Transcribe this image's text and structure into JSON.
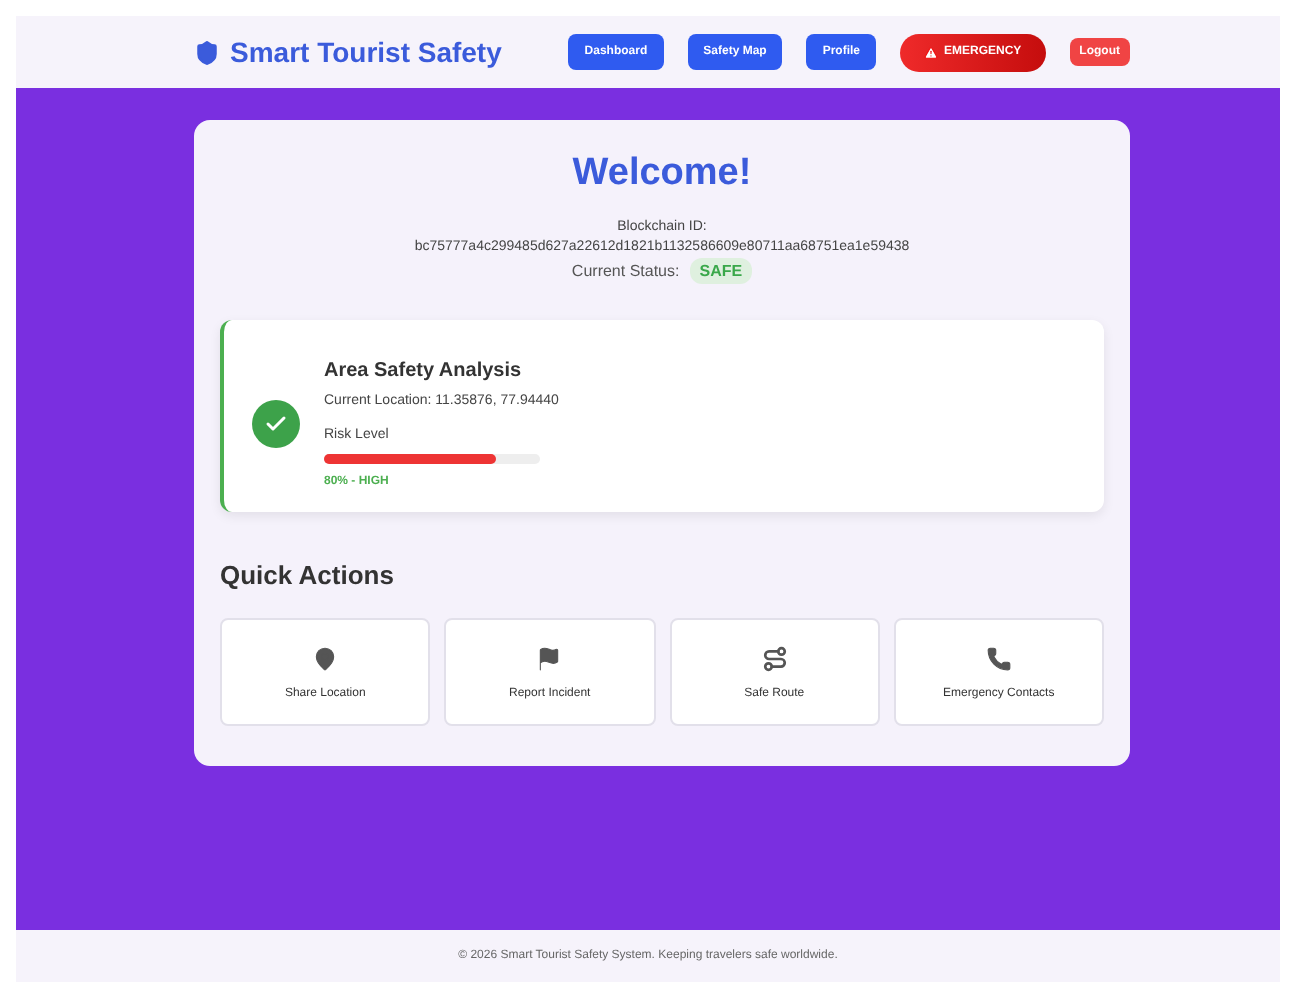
{
  "header": {
    "brand": "Smart Tourist Safety",
    "nav": [
      {
        "label": "Dashboard",
        "kind": "nav"
      },
      {
        "label": "Safety Map",
        "kind": "nav"
      },
      {
        "label": "Profile",
        "kind": "nav"
      },
      {
        "label": "EMERGENCY",
        "kind": "emergency"
      },
      {
        "label": "Logout",
        "kind": "logout"
      }
    ]
  },
  "welcome": {
    "title": "Welcome!",
    "id_label": "Blockchain ID:",
    "id_value": "bc75777a4c299485d627a22612d1821b1132586609e80711aa68751ea1e59438",
    "status_label": "Current Status:",
    "status": "SAFE"
  },
  "analysis": {
    "title": "Area Safety Analysis",
    "location": "Current Location: 11.35876, 77.94440",
    "risk_label": "Risk Level",
    "level": 0.8,
    "risk_reading": "80% - HIGH"
  },
  "quick_actions": {
    "title": "Quick Actions",
    "items": [
      {
        "label": "Share Location",
        "kind": "pin"
      },
      {
        "label": "Report Incident",
        "kind": "flag"
      },
      {
        "label": "Safe Route",
        "kind": "route"
      },
      {
        "label": "Emergency Contacts",
        "kind": "phone"
      }
    ]
  },
  "footer": "© 2026 Smart Tourist Safety System. Keeping travelers safe worldwide."
}
